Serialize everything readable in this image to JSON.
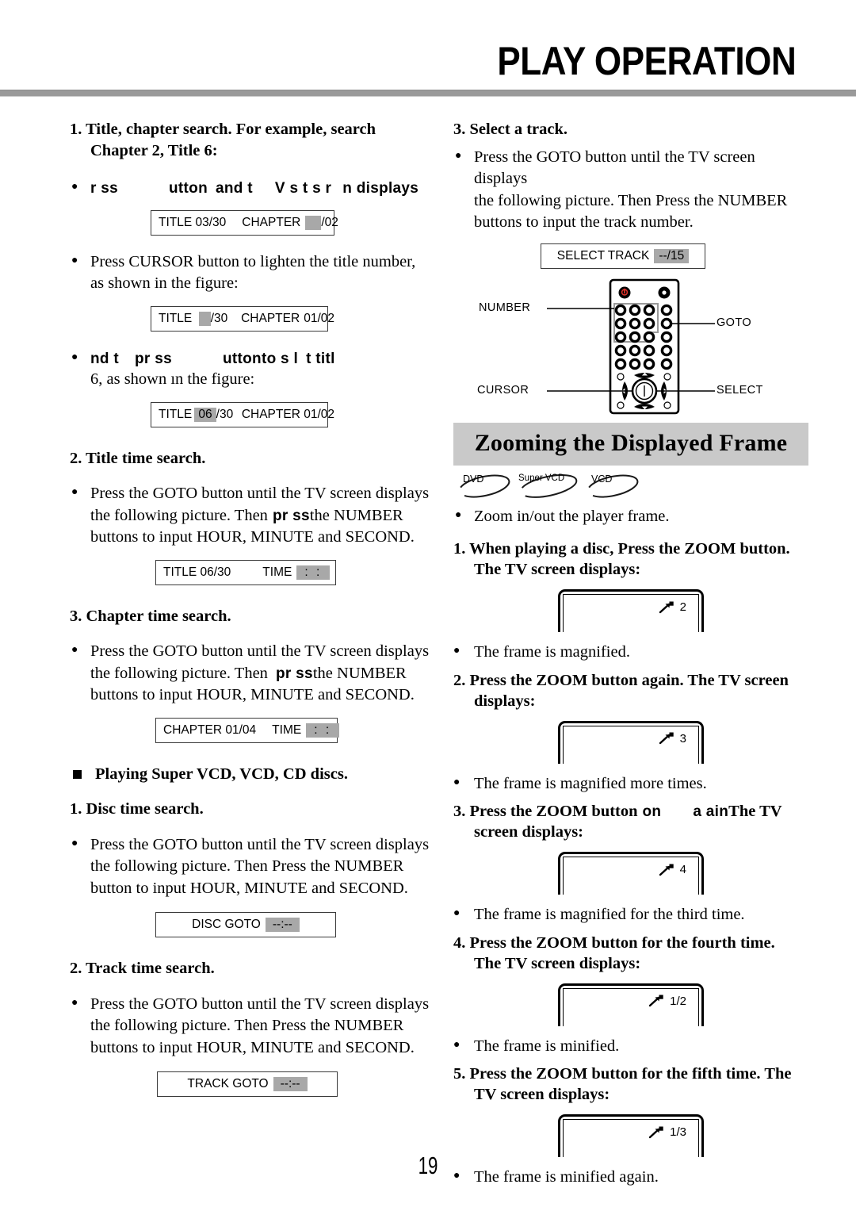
{
  "header": {
    "title": "PLAY OPERATION"
  },
  "page_number": "19",
  "left_column": {
    "item1": {
      "heading_line1": "1. Title, chapter search. For example, search",
      "heading_line2": "Chapter 2, Title 6:",
      "bullet1_fragments": [
        "r ss",
        "utton",
        "and t",
        "V s t s r",
        "n displays"
      ],
      "osd1": {
        "title_label": "TITLE 03/30",
        "chapter_label": "CHAPTER",
        "chapter_value_suffix": "/02"
      },
      "bullet2_line1": "Press CURSOR button to lighten the title number,",
      "bullet2_line2": "as shown in the figure:",
      "osd2": {
        "title_label": "TITLE",
        "title_value_suffix": "/30",
        "chapter_label": "CHAPTER",
        "chapter_value": "01/02"
      },
      "bullet3_fragments": [
        "nd t",
        "pr ss",
        "utton",
        "to s l",
        "t titl"
      ],
      "bullet3_line2": "6, as shown ın the figure:",
      "osd3": {
        "title_label": "TITLE",
        "title_value": "06",
        "title_value_suffix": "/30",
        "chapter_label": "CHAPTER 01/02"
      }
    },
    "item2": {
      "heading": "2. Title time search.",
      "body_line1": "Press the GOTO button until the TV screen displays",
      "body_line2_a": "the following picture. Then",
      "body_line2_frag": "pr  ss",
      "body_line2_b": "the NUMBER",
      "body_line3": "buttons to input HOUR, MINUTE and SECOND.",
      "osd": {
        "title_label": "TITLE 06/30",
        "time_label": "TIME",
        "time_value": ":   :"
      }
    },
    "item3": {
      "heading": "3. Chapter time search.",
      "body_line1": "Press the GOTO button until the TV screen displays",
      "body_line2_a": "the following picture. Then",
      "body_line2_frag": "pr  ss",
      "body_line2_b": "the NUMBER",
      "body_line3": "buttons to input HOUR, MINUTE and SECOND.",
      "osd": {
        "chapter_label": "CHAPTER 01/04",
        "time_label": "TIME",
        "time_value": ":   :"
      }
    },
    "section_heading": "Playing Super VCD, VCD, CD discs.",
    "item4": {
      "heading": "1. Disc time search.",
      "body_line1": "Press the GOTO button until the TV screen displays",
      "body_line2": "the following picture. Then Press the NUMBER",
      "body_line3": "button to input HOUR, MINUTE and SECOND.",
      "osd": {
        "label": "DISC GOTO",
        "value": "--:--"
      }
    },
    "item5": {
      "heading": "2. Track time search.",
      "body_line1": "Press the GOTO button until the TV screen displays",
      "body_line2": "the following picture. Then Press the NUMBER",
      "body_line3": "buttons to input HOUR, MINUTE and SECOND.",
      "osd": {
        "label": "TRACK GOTO",
        "value": "--:--"
      }
    }
  },
  "right_column": {
    "item3": {
      "heading": "3. Select a track.",
      "body_line1": "Press the GOTO button until the TV screen displays",
      "body_line2": "the following picture. Then Press the NUMBER",
      "body_line3": "buttons to input the track number.",
      "osd": {
        "label": "SELECT TRACK",
        "value": "--/15"
      }
    },
    "remote": {
      "labels": {
        "number": "NUMBER",
        "goto": "GOTO",
        "cursor": "CURSOR",
        "select": "SELECT"
      },
      "power_color": "#d83029"
    },
    "banner": "Zooming the Displayed Frame",
    "disc_badges": [
      "DVD",
      "Super VCD",
      "VCD"
    ],
    "intro_bullet": "Zoom in/out the player frame.",
    "steps": [
      {
        "heading_line1": "1. When playing a disc, Press the ZOOM button.",
        "heading_line2": "The TV screen displays:",
        "zoom_value": "2",
        "note": "The frame is magnified."
      },
      {
        "heading_line1": "2. Press the ZOOM button again. The TV screen",
        "heading_line2": "displays:",
        "zoom_value": "3",
        "note": "The frame is magnified more times."
      },
      {
        "heading_frag_a": "3. Press the ZOOM button",
        "heading_frag_b": "on",
        "heading_frag_c": "a  ain",
        "heading_frag_d": "The TV",
        "heading_line2": "screen displays:",
        "zoom_value": "4",
        "note": "The frame is magnified for the third time."
      },
      {
        "heading_line1": "4. Press the ZOOM button for the fourth time.",
        "heading_line2": "The TV screen displays:",
        "zoom_value": "1/2",
        "note": "The frame is minified."
      },
      {
        "heading_line1": "5. Press the ZOOM button for the fifth time. The",
        "heading_line2": "TV screen displays:",
        "zoom_value": "1/3",
        "note": "The frame is minified again."
      }
    ]
  }
}
